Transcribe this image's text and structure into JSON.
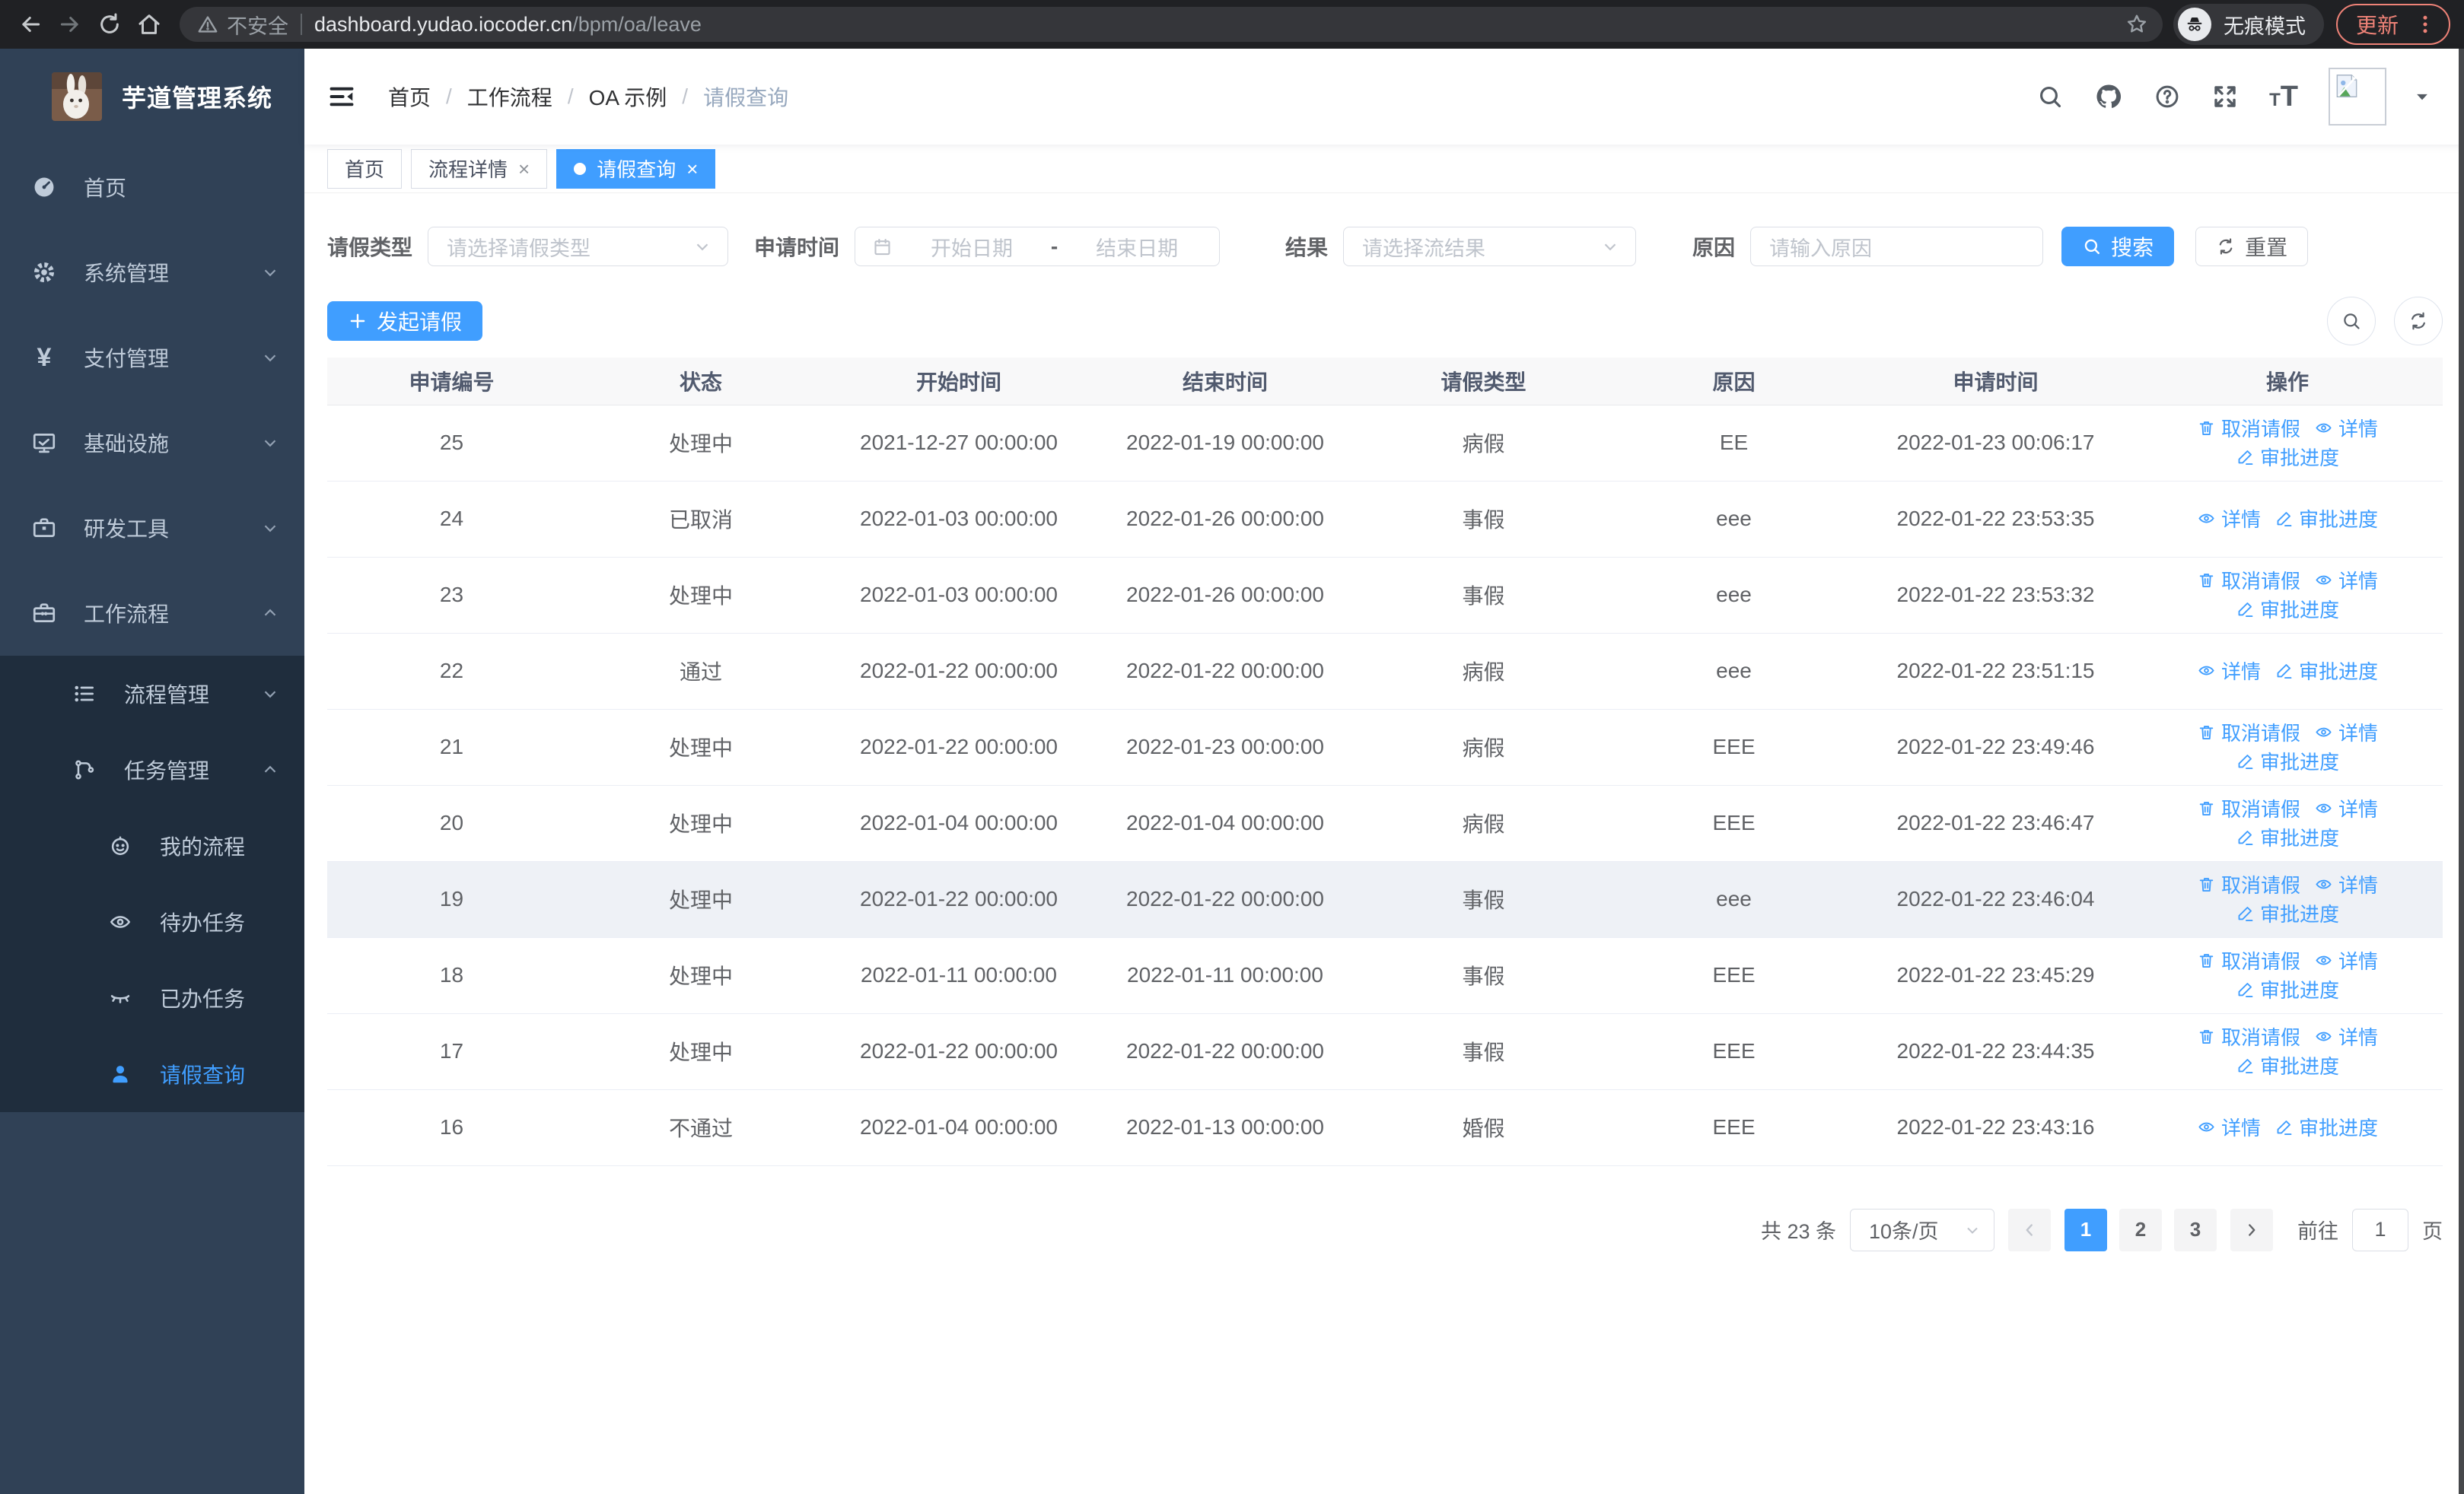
{
  "browser": {
    "security_label": "不安全",
    "url_host": "dashboard.yudao.iocoder.cn",
    "url_path": "/bpm/oa/leave",
    "incognito_label": "无痕模式",
    "update_label": "更新"
  },
  "sidebar": {
    "logo_title": "芋道管理系统",
    "items": [
      {
        "label": "首页"
      },
      {
        "label": "系统管理"
      },
      {
        "label": "支付管理"
      },
      {
        "label": "基础设施"
      },
      {
        "label": "研发工具"
      },
      {
        "label": "工作流程"
      },
      {
        "label": "流程管理"
      },
      {
        "label": "任务管理"
      },
      {
        "label": "我的流程"
      },
      {
        "label": "待办任务"
      },
      {
        "label": "已办任务"
      },
      {
        "label": "请假查询"
      }
    ]
  },
  "header": {
    "breadcrumb": [
      "首页",
      "工作流程",
      "OA 示例",
      "请假查询"
    ]
  },
  "tabs": [
    {
      "label": "首页"
    },
    {
      "label": "流程详情"
    },
    {
      "label": "请假查询"
    }
  ],
  "filters": {
    "type_label": "请假类型",
    "type_placeholder": "请选择请假类型",
    "time_label": "申请时间",
    "time_start_placeholder": "开始日期",
    "time_separator": "-",
    "time_end_placeholder": "结束日期",
    "result_label": "结果",
    "result_placeholder": "请选择流结果",
    "reason_label": "原因",
    "reason_placeholder": "请输入原因",
    "search_label": "搜索",
    "reset_label": "重置"
  },
  "toolbar": {
    "create_label": "发起请假"
  },
  "table": {
    "columns": [
      "申请编号",
      "状态",
      "开始时间",
      "结束时间",
      "请假类型",
      "原因",
      "申请时间",
      "操作"
    ],
    "action_defs": {
      "cancel": {
        "label": "取消请假",
        "icon": "trash-icon"
      },
      "detail": {
        "label": "详情",
        "icon": "eye-icon"
      },
      "progress": {
        "label": "审批进度",
        "icon": "pen-icon"
      }
    },
    "rows": [
      {
        "id": "25",
        "status": "处理中",
        "start": "2021-12-27 00:00:00",
        "end": "2022-01-19 00:00:00",
        "type": "病假",
        "reason": "EE",
        "applied": "2022-01-23 00:06:17",
        "actions": [
          "cancel",
          "detail",
          "progress"
        ],
        "highlight": false
      },
      {
        "id": "24",
        "status": "已取消",
        "start": "2022-01-03 00:00:00",
        "end": "2022-01-26 00:00:00",
        "type": "事假",
        "reason": "eee",
        "applied": "2022-01-22 23:53:35",
        "actions": [
          "detail",
          "progress"
        ],
        "highlight": false
      },
      {
        "id": "23",
        "status": "处理中",
        "start": "2022-01-03 00:00:00",
        "end": "2022-01-26 00:00:00",
        "type": "事假",
        "reason": "eee",
        "applied": "2022-01-22 23:53:32",
        "actions": [
          "cancel",
          "detail",
          "progress"
        ],
        "highlight": false
      },
      {
        "id": "22",
        "status": "通过",
        "start": "2022-01-22 00:00:00",
        "end": "2022-01-22 00:00:00",
        "type": "病假",
        "reason": "eee",
        "applied": "2022-01-22 23:51:15",
        "actions": [
          "detail",
          "progress"
        ],
        "highlight": false
      },
      {
        "id": "21",
        "status": "处理中",
        "start": "2022-01-22 00:00:00",
        "end": "2022-01-23 00:00:00",
        "type": "病假",
        "reason": "EEE",
        "applied": "2022-01-22 23:49:46",
        "actions": [
          "cancel",
          "detail",
          "progress"
        ],
        "highlight": false
      },
      {
        "id": "20",
        "status": "处理中",
        "start": "2022-01-04 00:00:00",
        "end": "2022-01-04 00:00:00",
        "type": "病假",
        "reason": "EEE",
        "applied": "2022-01-22 23:46:47",
        "actions": [
          "cancel",
          "detail",
          "progress"
        ],
        "highlight": false
      },
      {
        "id": "19",
        "status": "处理中",
        "start": "2022-01-22 00:00:00",
        "end": "2022-01-22 00:00:00",
        "type": "事假",
        "reason": "eee",
        "applied": "2022-01-22 23:46:04",
        "actions": [
          "cancel",
          "detail",
          "progress"
        ],
        "highlight": true
      },
      {
        "id": "18",
        "status": "处理中",
        "start": "2022-01-11 00:00:00",
        "end": "2022-01-11 00:00:00",
        "type": "事假",
        "reason": "EEE",
        "applied": "2022-01-22 23:45:29",
        "actions": [
          "cancel",
          "detail",
          "progress"
        ],
        "highlight": false
      },
      {
        "id": "17",
        "status": "处理中",
        "start": "2022-01-22 00:00:00",
        "end": "2022-01-22 00:00:00",
        "type": "事假",
        "reason": "EEE",
        "applied": "2022-01-22 23:44:35",
        "actions": [
          "cancel",
          "detail",
          "progress"
        ],
        "highlight": false
      },
      {
        "id": "16",
        "status": "不通过",
        "start": "2022-01-04 00:00:00",
        "end": "2022-01-13 00:00:00",
        "type": "婚假",
        "reason": "EEE",
        "applied": "2022-01-22 23:43:16",
        "actions": [
          "detail",
          "progress"
        ],
        "highlight": false
      }
    ]
  },
  "pagination": {
    "total_label": "共 23 条",
    "page_size": "10条/页",
    "pages": [
      "1",
      "2",
      "3"
    ],
    "active_page": "1",
    "goto_label": "前往",
    "goto_value": "1",
    "goto_suffix": "页"
  },
  "colors": {
    "primary": "#409eff",
    "sidebar_bg": "#304156",
    "submenu_bg": "#1f2d3d",
    "chrome_bg": "#202124",
    "update_accent": "#ee8277",
    "highlight_row": "#eef1f6"
  }
}
